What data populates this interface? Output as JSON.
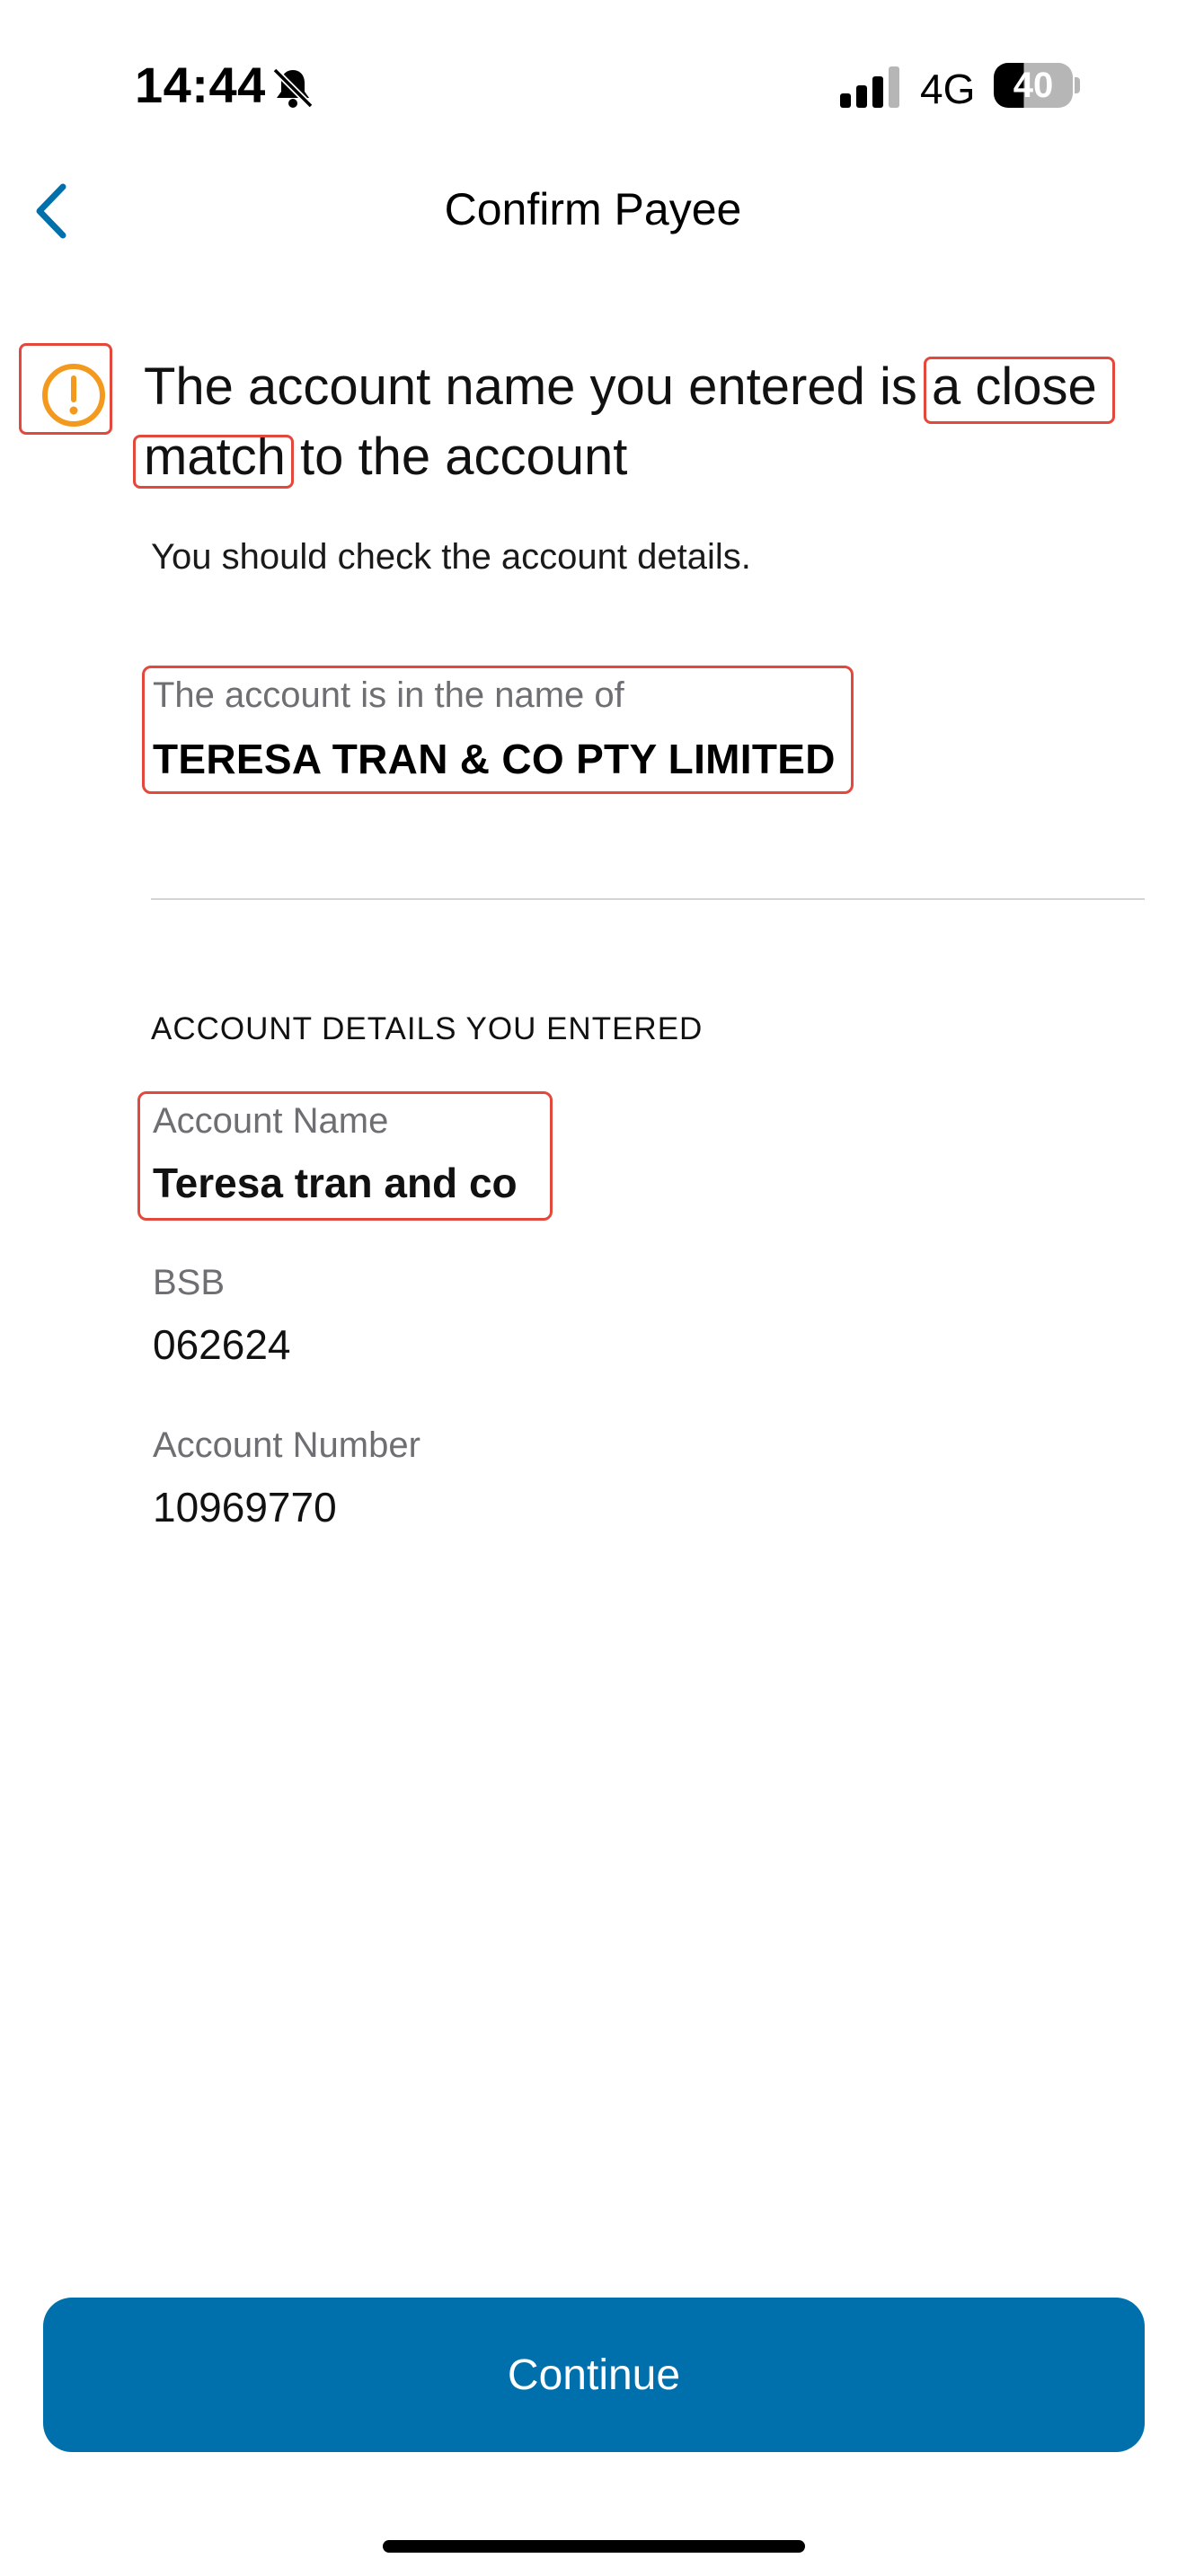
{
  "status_bar": {
    "time": "14:44",
    "network": "4G",
    "battery": "40"
  },
  "nav": {
    "title": "Confirm Payee"
  },
  "warning": {
    "heading": "The account name you entered is a close match to the account",
    "subtext": "You should check the account details."
  },
  "account_holder": {
    "label": "The account is in the name of",
    "name": "TERESA TRAN & CO PTY LIMITED"
  },
  "entered_details": {
    "section_title": "ACCOUNT DETAILS YOU ENTERED",
    "fields": [
      {
        "label": "Account Name",
        "value": "Teresa tran and co"
      },
      {
        "label": "BSB",
        "value": "062624"
      },
      {
        "label": "Account Number",
        "value": "10969770"
      }
    ]
  },
  "actions": {
    "continue_label": "Continue"
  },
  "colors": {
    "accent_blue": "#0070ad",
    "warning_orange": "#f39a1e",
    "highlight_red": "#e3483c"
  },
  "icons": [
    "bell-slash-icon",
    "cellular-signal-icon",
    "battery-icon",
    "chevron-left-icon",
    "warning-icon"
  ]
}
